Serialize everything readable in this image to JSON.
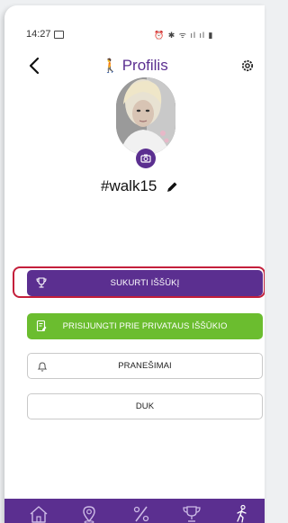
{
  "status_bar": {
    "time": "14:27",
    "icons": "⏰ ✱ ᯤ ıl ıl ▮"
  },
  "header": {
    "title": "Profilis",
    "title_icon": "walker-icon",
    "back_icon": "chevron-left-icon",
    "settings_icon": "gear-icon"
  },
  "profile": {
    "username": "#walk15",
    "edit_icon": "pencil-icon",
    "camera_icon": "camera-icon"
  },
  "actions": {
    "create_challenge": "SUKURTI IŠŠŪKĮ",
    "join_private": "PRISIJUNGTI PRIE PRIVATAUS IŠŠŪKIO",
    "notifications": "PRANEŠIMAI",
    "faq": "DUK"
  },
  "tabbar": {
    "items": [
      "home-icon",
      "location-icon",
      "percent-icon",
      "trophy-icon",
      "walker-icon"
    ]
  },
  "colors": {
    "primary": "#5b2f90",
    "green": "#6bbd2f",
    "highlight": "#c41f3b"
  }
}
